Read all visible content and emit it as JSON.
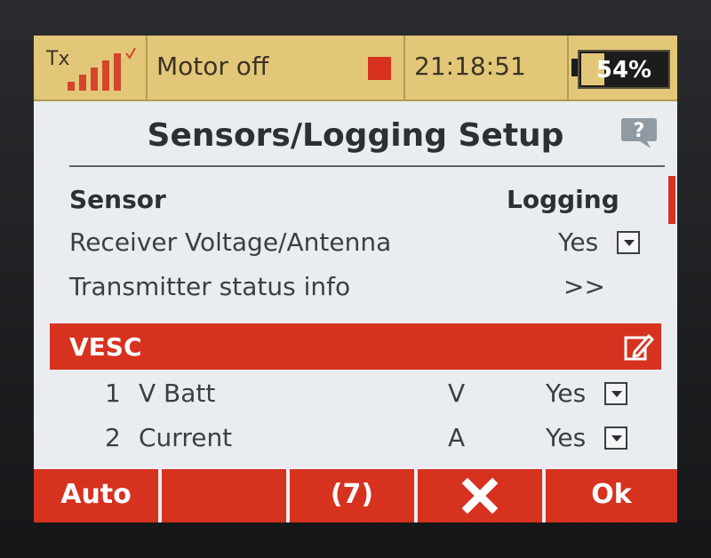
{
  "status_bar": {
    "tx_label": "Tx",
    "signal_bars": 5,
    "motor_status": "Motor off",
    "time": "21:18:51",
    "battery_percent_text": "54%",
    "battery_level": 0.54,
    "accent_color": "#e3c779",
    "motor_indicator_color": "#d9311f"
  },
  "title": "Sensors/Logging Setup",
  "help_icon": "help-question-icon",
  "headers": {
    "sensor": "Sensor",
    "logging": "Logging"
  },
  "rows": [
    {
      "label": "Receiver Voltage/Antenna",
      "value": "Yes",
      "has_dropdown": true
    },
    {
      "label": "Transmitter status info",
      "value": ">>",
      "has_dropdown": false
    }
  ],
  "group": {
    "label": "VESC",
    "icon": "edit-icon",
    "color": "#d6321f"
  },
  "group_rows": [
    {
      "index": "1",
      "name": "V Batt",
      "unit": "V",
      "value": "Yes"
    },
    {
      "index": "2",
      "name": "Current",
      "unit": "A",
      "value": "Yes"
    }
  ],
  "softkeys": {
    "k1": "Auto",
    "k2": "",
    "k3": "(7)",
    "k4_icon": "close-x-icon",
    "k5": "Ok"
  }
}
